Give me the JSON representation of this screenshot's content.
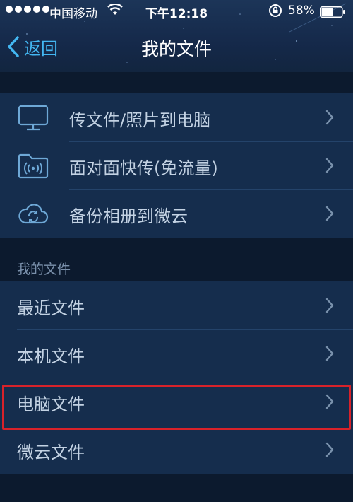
{
  "status_bar": {
    "carrier": "中国移动",
    "time": "下午12:18",
    "battery": "58%",
    "battery_level": 0.58,
    "icons": [
      "signal-dots-icon",
      "wifi-icon",
      "orientation-lock-icon",
      "battery-icon"
    ]
  },
  "nav": {
    "back_label": "返回",
    "title": "我的文件"
  },
  "quick_actions": [
    {
      "label": "传文件/照片到电脑",
      "icon": "monitor-icon"
    },
    {
      "label": "面对面快传(免流量)",
      "icon": "folder-wireless-icon"
    },
    {
      "label": "备份相册到微云",
      "icon": "cloud-sync-icon"
    }
  ],
  "section_header": "我的文件",
  "files": [
    {
      "label": "最近文件"
    },
    {
      "label": "本机文件"
    },
    {
      "label": "电脑文件",
      "highlighted": true
    },
    {
      "label": "微云文件"
    }
  ],
  "colors": {
    "background": "#0c1a2e",
    "row_bg": "#152d4d",
    "accent": "#43b7f2",
    "highlight": "#d8222a"
  }
}
